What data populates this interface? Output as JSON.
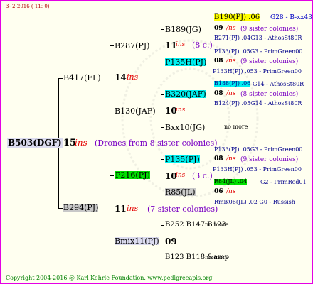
{
  "header": {
    "date": "3- 2-2016 ( 11: 0)"
  },
  "root": {
    "id": "B503(DGF)",
    "num": "15",
    "ins": "ins",
    "note": "(Drones from 8 sister colonies)"
  },
  "gen1": {
    "top": {
      "id": "B417(FL)",
      "num": "14",
      "ins": "ins"
    },
    "bottom": {
      "id": "B294(PJ)",
      "num": "11",
      "ins": "ins",
      "note": "(7 sister colonies)"
    }
  },
  "gen2": {
    "a": {
      "id": "B287(PJ)"
    },
    "b": {
      "id": "B130(JAF)",
      "num": "10",
      "ins": "ins"
    },
    "c": {
      "id": "P216(PJ)",
      "num": "10",
      "ins": "ins",
      "note": "(3 c.)"
    },
    "d": {
      "id": "Bmix11(PJ)",
      "num": "09"
    }
  },
  "gen3": {
    "a": {
      "id": "B189(JG)",
      "num": "11",
      "ins": "ins",
      "note": "(8 c.)"
    },
    "b": {
      "id": "P135H(PJ)"
    },
    "c": {
      "id": "B320(JAF)",
      "num": "08",
      "ins": "ins"
    },
    "d": {
      "id": "Bxx10(JG)"
    },
    "e": {
      "id": "P135(PJ)"
    },
    "f": {
      "id": "R85(JL)"
    },
    "g": {
      "id": "B252 B147 B123"
    },
    "h": {
      "id": "B123 B118 &amp"
    }
  },
  "leaves": [
    {
      "l1_id": "B190(PJ) .06",
      "l1_code": "G28 - B-xx43",
      "num": "09",
      "ins": "/ns",
      "note": "(9 sister colonies)",
      "l3": "B271(PJ) .04G13 - AthosSt80R"
    },
    {
      "l1_id": "P133(PJ) .05G3 - PrimGreen00",
      "l1_code": "",
      "num": "08",
      "ins": "/ns",
      "note": "(9 sister colonies)",
      "l3": "P133H(PJ) .053 - PrimGreen00"
    },
    {
      "l1_id": "B188(PJ) .06",
      "l1_code": "G14 - AthosSt80R",
      "num": "08",
      "ins": "/ns",
      "note": "(8 sister colonies)",
      "l3": "B124(PJ) .05G14 - AthosSt80R"
    },
    {
      "single": "no more"
    },
    {
      "l1_id": "P133(PJ) .05G3 - PrimGreen00",
      "l1_code": "",
      "num": "08",
      "ins": "/ns",
      "note": "(9 sister colonies)",
      "l3": "P133H(PJ) .053 - PrimGreen00"
    },
    {
      "l1_id": "R84(JL) .04",
      "l1_code": "G2 - PrimRed01",
      "num": "06",
      "ins": "/ns",
      "note": "",
      "l3": "Rmix06(JL) .02     G0 - Russish"
    },
    {
      "single": "no more"
    },
    {
      "single": "no more"
    }
  ],
  "footer": {
    "copyright": "Copyright 2004-2016 @ Karl Kehrle Foundation.   www.pedigreeapis.org"
  },
  "colors": {
    "frame": "#e400e4",
    "background": "#fffff0",
    "ins": "#e40000",
    "sister": "#7a00c4",
    "code": "#0000c4",
    "yellow": "#ffff00",
    "cyan": "#00f0f0",
    "green": "#00e000",
    "gray": "#c8c8c8",
    "lavender": "#dcdcf0"
  }
}
